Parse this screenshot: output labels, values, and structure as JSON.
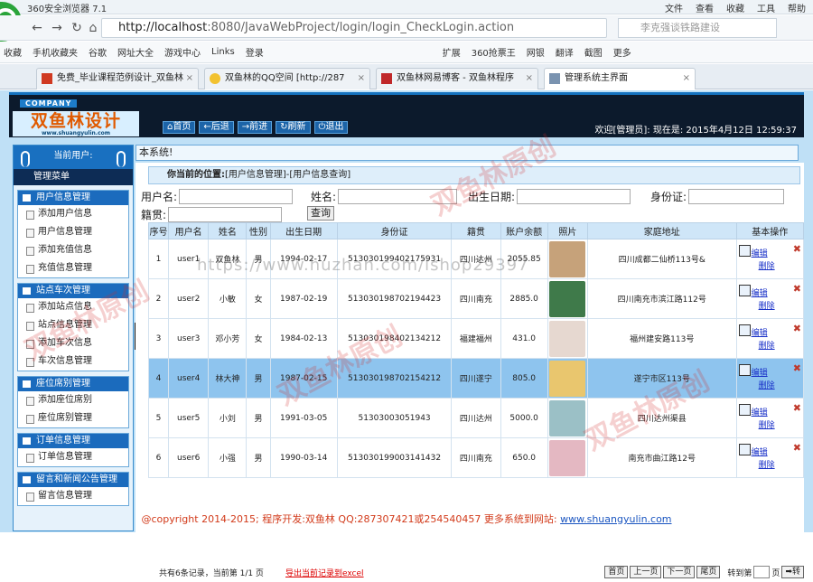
{
  "browser": {
    "title": "360安全浏览器 7.1",
    "menus": [
      "文件",
      "查看",
      "收藏",
      "工具",
      "帮助"
    ],
    "url_host": "http://localhost",
    "url_path": ":8080/JavaWebProject/login/login_CheckLogin.action",
    "search_placeholder": "李克强谈铁路建设",
    "favorites": [
      "收藏",
      "手机收藏夹",
      "谷歌",
      "网址大全",
      "游戏中心",
      "Links",
      "登录",
      "扩展",
      "360抢票王",
      "网银",
      "翻译",
      "截图",
      "更多"
    ],
    "tabs": [
      {
        "label": "免费_毕业课程范例设计_双鱼林"
      },
      {
        "label": "双鱼林的QQ空间 [http://287"
      },
      {
        "label": "双鱼林网易博客 - 双鱼林程序"
      },
      {
        "label": "管理系统主界面"
      }
    ]
  },
  "header": {
    "company": "COMPANY",
    "brand": "双鱼林设计",
    "brand_sub": "www.shuangyulin.com",
    "buttons": [
      "首页",
      "后退",
      "前进",
      "刷新",
      "退出"
    ],
    "welcome": "欢迎[管理员]:   现在是: 2015年4月12日  12:59:37"
  },
  "sidebar": {
    "current_user": "当前用户:",
    "menu_title": "管理菜单",
    "groups": [
      {
        "title": "用户信息管理",
        "items": [
          "添加用户信息",
          "用户信息管理",
          "添加充值信息",
          "充值信息管理"
        ]
      },
      {
        "title": "站点车次管理",
        "items": [
          "添加站点信息",
          "站点信息管理",
          "添加车次信息",
          "车次信息管理"
        ]
      },
      {
        "title": "座位席别管理",
        "items": [
          "添加座位席别",
          "座位席别管理"
        ]
      },
      {
        "title": "订单信息管理",
        "items": [
          "订单信息管理"
        ]
      },
      {
        "title": "留言和新闻公告管理",
        "items": [
          "留言信息管理"
        ]
      }
    ]
  },
  "main": {
    "welcome_bar": "本系统!",
    "crumb_label": "你当前的位置:",
    "crumb_path": "[用户信息管理]-[用户信息查询]",
    "filter": {
      "username_label": "用户名:",
      "name_label": "姓名:",
      "birth_label": "出生日期:",
      "id_label": "身份证:",
      "native_label": "籍贯:",
      "query_button": "查询"
    },
    "table": {
      "headers": [
        "序号",
        "用户名",
        "姓名",
        "性别",
        "出生日期",
        "身份证",
        "籍贯",
        "账户余额",
        "照片",
        "家庭地址",
        "基本操作"
      ],
      "rows": [
        [
          "1",
          "user1",
          "双鱼林",
          "男",
          "1994-02-17",
          "513030199402175931",
          "四川达州",
          "2055.85",
          "四川成都二仙桥113号&"
        ],
        [
          "2",
          "user2",
          "小敏",
          "女",
          "1987-02-19",
          "513030198702194423",
          "四川南充",
          "2885.0",
          "四川南充市滨江路112号"
        ],
        [
          "3",
          "user3",
          "邓小芳",
          "女",
          "1984-02-13",
          "513030198402134212",
          "福建福州",
          "431.0",
          "福州建安路113号"
        ],
        [
          "4",
          "user4",
          "林大神",
          "男",
          "1987-02-15",
          "513030198702154212",
          "四川遂宁",
          "805.0",
          "遂宁市区113号"
        ],
        [
          "5",
          "user5",
          "小刘",
          "男",
          "1991-03-05",
          "51303003051943",
          "四川达州",
          "5000.0",
          "四川达州渠县"
        ],
        [
          "6",
          "user6",
          "小强",
          "男",
          "1990-03-14",
          "513030199003141432",
          "四川南充",
          "650.0",
          "南充市曲江路12号"
        ]
      ],
      "edit_label": "编辑",
      "delete_label": "删除",
      "delete_mark": "✖",
      "photo_colors": [
        "#c6a27a",
        "#3f7a4a",
        "#e6d8d0",
        "#e9c66e",
        "#9bc0c6",
        "#e4b8c2"
      ]
    },
    "pager": {
      "info": "共有6条记录，当前第 1/1 页",
      "export": "导出当前记录到excel",
      "first": "首页",
      "prev": "上一页",
      "next": "下一页",
      "last": "尾页",
      "goto": "转到第",
      "page_unit": "页",
      "go": "转"
    }
  },
  "footer": {
    "text": "@copyright 2014-2015; 程序开发:双鱼林  QQ:287307421或254540457  更多系统到网站: ",
    "link": "www.shuangyulin.com"
  },
  "watermark": {
    "url": "https://www.huzhan.com/ishop29397",
    "text": "双鱼林原创"
  }
}
